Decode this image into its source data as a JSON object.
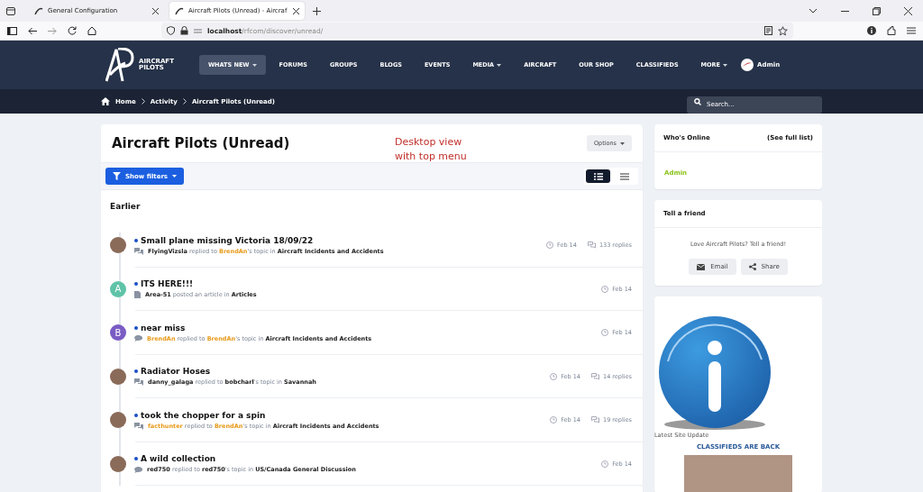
{
  "browser": {
    "tabs": [
      {
        "title": "General Configuration",
        "selected": false
      },
      {
        "title": "Aircraft Pilots (Unread) - Aircraf",
        "selected": true
      }
    ],
    "url_host": "localhost",
    "url_path": "/rfcom/discover/unread/"
  },
  "site": {
    "logo_line1": "AIRCRAFT",
    "logo_line2": "PILOTS",
    "nav": [
      {
        "label": "WHATS NEW",
        "selected": true,
        "dropdown": true
      },
      {
        "label": "FORUMS",
        "selected": false,
        "dropdown": false
      },
      {
        "label": "GROUPS",
        "selected": false,
        "dropdown": false
      },
      {
        "label": "BLOGS",
        "selected": false,
        "dropdown": false
      },
      {
        "label": "EVENTS",
        "selected": false,
        "dropdown": false
      },
      {
        "label": "MEDIA",
        "selected": false,
        "dropdown": true
      },
      {
        "label": "AIRCRAFT",
        "selected": false,
        "dropdown": false
      },
      {
        "label": "OUR SHOP",
        "selected": false,
        "dropdown": false
      },
      {
        "label": "CLASSIFIEDS",
        "selected": false,
        "dropdown": false
      },
      {
        "label": "MORE",
        "selected": false,
        "dropdown": true
      }
    ],
    "user": "Admin",
    "search_placeholder": "Search..."
  },
  "breadcrumb": [
    "Home",
    "Activity",
    "Aircraft Pilots (Unread)"
  ],
  "page": {
    "title": "Aircraft Pilots (Unread)",
    "options_button": "Options",
    "annotation": [
      "Desktop view",
      "with top menu"
    ],
    "filter_button": "Show filters",
    "view_toggle": [
      {
        "kind": "expanded",
        "selected": true
      },
      {
        "kind": "condensed",
        "selected": false
      }
    ],
    "section": "Earlier",
    "items": [
      {
        "title": "Small plane missing Victoria 18/09/22",
        "unread": true,
        "kind": "topic",
        "avatar": {
          "kind": "photo"
        },
        "meta": [
          {
            "kind": "user",
            "text": "FlyingVizsla"
          },
          {
            "kind": "text",
            "text": " replied to "
          },
          {
            "kind": "member",
            "text": "BrendAn"
          },
          {
            "kind": "text",
            "text": "'s topic in "
          },
          {
            "kind": "user",
            "text": "Aircraft Incidents and Accidents"
          }
        ],
        "date": "Feb 14",
        "replies": "133 replies"
      },
      {
        "title": "ITS HERE!!!",
        "unread": true,
        "kind": "article",
        "avatar": {
          "kind": "letter",
          "letter": "A",
          "color": "#5fc3a8"
        },
        "meta": [
          {
            "kind": "user",
            "text": "Area-51"
          },
          {
            "kind": "text",
            "text": " posted an article in "
          },
          {
            "kind": "user",
            "text": "Articles"
          }
        ],
        "date": "Feb 14"
      },
      {
        "title": "near miss",
        "unread": true,
        "kind": "reply",
        "avatar": {
          "kind": "letter",
          "letter": "B",
          "color": "#7a5cc4"
        },
        "meta": [
          {
            "kind": "member",
            "text": "BrendAn"
          },
          {
            "kind": "text",
            "text": " replied to "
          },
          {
            "kind": "member",
            "text": "BrendAn"
          },
          {
            "kind": "text",
            "text": "'s topic in "
          },
          {
            "kind": "user",
            "text": "Aircraft Incidents and Accidents"
          }
        ],
        "date": "Feb 14"
      },
      {
        "title": "Radiator Hoses",
        "unread": true,
        "kind": "topic",
        "avatar": {
          "kind": "photo"
        },
        "meta": [
          {
            "kind": "user",
            "text": "danny_galaga"
          },
          {
            "kind": "text",
            "text": " replied to "
          },
          {
            "kind": "user",
            "text": "bobcharl"
          },
          {
            "kind": "text",
            "text": "'s topic in "
          },
          {
            "kind": "user",
            "text": "Savannah"
          }
        ],
        "date": "Feb 14",
        "replies": "14 replies"
      },
      {
        "title": "took the chopper for a spin",
        "unread": true,
        "kind": "topic",
        "avatar": {
          "kind": "photo"
        },
        "meta": [
          {
            "kind": "member",
            "text": "facthunter"
          },
          {
            "kind": "text",
            "text": " replied to "
          },
          {
            "kind": "member",
            "text": "BrendAn"
          },
          {
            "kind": "text",
            "text": "'s topic in "
          },
          {
            "kind": "user",
            "text": "Aircraft Incidents and Accidents"
          }
        ],
        "date": "Feb 14",
        "replies": "19 replies"
      },
      {
        "title": "A wild collection",
        "unread": true,
        "kind": "reply",
        "avatar": {
          "kind": "photo"
        },
        "meta": [
          {
            "kind": "user",
            "text": "red750"
          },
          {
            "kind": "text",
            "text": " replied to "
          },
          {
            "kind": "user",
            "text": "red750"
          },
          {
            "kind": "text",
            "text": "'s topic in "
          },
          {
            "kind": "user",
            "text": "US/Canada General Discussion"
          }
        ],
        "date": "Feb 14"
      }
    ]
  },
  "sidebar": {
    "online": {
      "title": "Who's Online",
      "link": "(See full list)",
      "users": [
        "Admin"
      ]
    },
    "friend": {
      "title": "Tell a friend",
      "text": "Love Aircraft Pilots? Tell a friend!",
      "buttons": [
        {
          "kind": "email",
          "label": "Email"
        },
        {
          "kind": "share",
          "label": "Share"
        }
      ]
    },
    "update": {
      "caption": "Latest Site Update",
      "heading": "CLASSIFIEDS ARE BACK"
    }
  }
}
